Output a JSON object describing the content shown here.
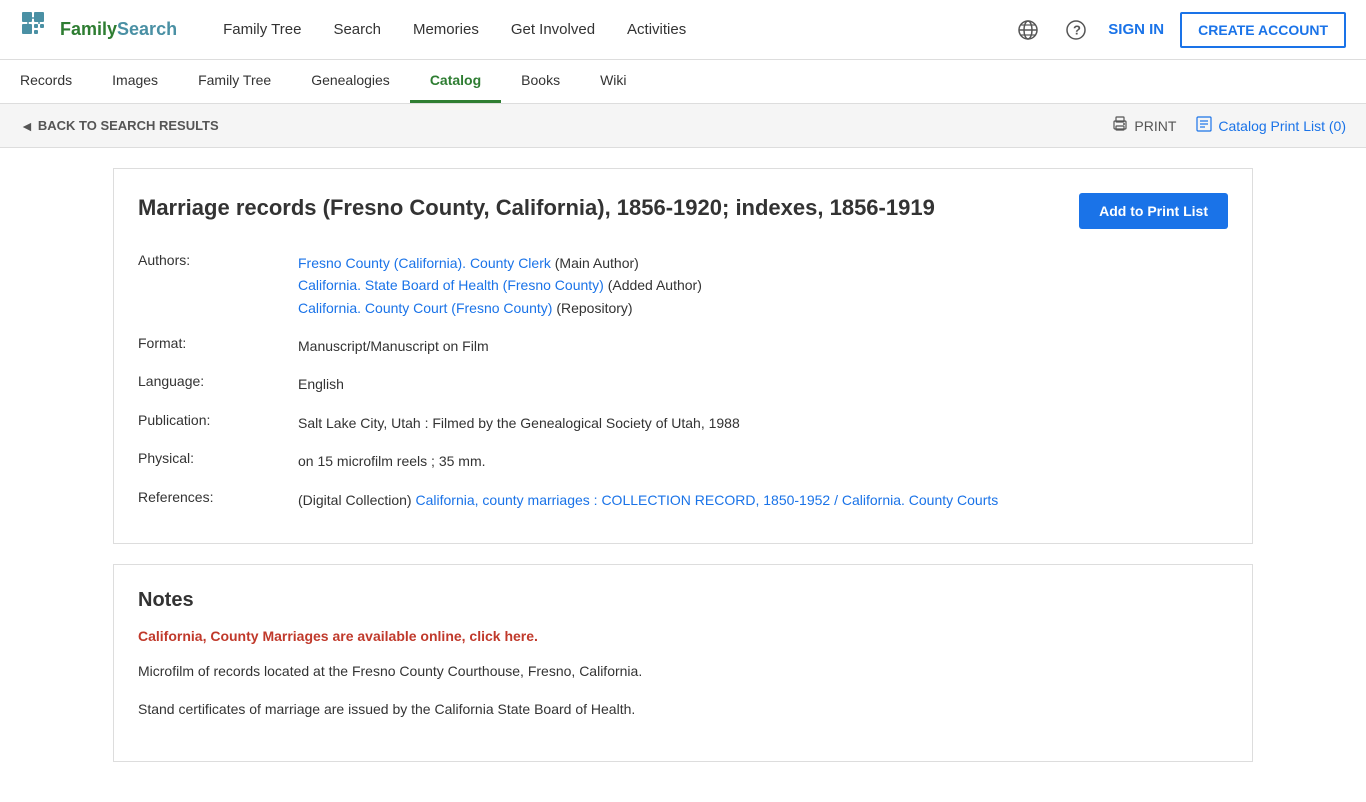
{
  "logo": {
    "brand_name": "FamilySearch",
    "brand_prefix": "Family",
    "brand_suffix": "Search"
  },
  "top_nav": {
    "items": [
      {
        "id": "family-tree",
        "label": "Family Tree"
      },
      {
        "id": "search",
        "label": "Search"
      },
      {
        "id": "memories",
        "label": "Memories"
      },
      {
        "id": "get-involved",
        "label": "Get Involved"
      },
      {
        "id": "activities",
        "label": "Activities"
      }
    ],
    "sign_in_label": "SIGN IN",
    "create_account_label": "CREATE ACCOUNT"
  },
  "sub_nav": {
    "items": [
      {
        "id": "records",
        "label": "Records",
        "active": false
      },
      {
        "id": "images",
        "label": "Images",
        "active": false
      },
      {
        "id": "family-tree",
        "label": "Family Tree",
        "active": false
      },
      {
        "id": "genealogies",
        "label": "Genealogies",
        "active": false
      },
      {
        "id": "catalog",
        "label": "Catalog",
        "active": true
      },
      {
        "id": "books",
        "label": "Books",
        "active": false
      },
      {
        "id": "wiki",
        "label": "Wiki",
        "active": false
      }
    ]
  },
  "breadcrumb": {
    "back_label": "BACK TO SEARCH RESULTS",
    "print_label": "PRINT",
    "catalog_print_label": "Catalog Print List (0)"
  },
  "record": {
    "title": "Marriage records (Fresno County, California), 1856-1920; indexes, 1856-1919",
    "add_to_print_label": "Add to Print List",
    "authors_label": "Authors:",
    "authors": [
      {
        "name": "Fresno County (California). County Clerk",
        "role": " (Main Author)"
      },
      {
        "name": "California. State Board of Health (Fresno County)",
        "role": " (Added Author)"
      },
      {
        "name": "California. County Court (Fresno County)",
        "role": " (Repository)"
      }
    ],
    "format_label": "Format:",
    "format_value": "Manuscript/Manuscript on Film",
    "language_label": "Language:",
    "language_value": "English",
    "publication_label": "Publication:",
    "publication_value": "Salt Lake City, Utah : Filmed by the Genealogical Society of Utah, 1988",
    "physical_label": "Physical:",
    "physical_value": "on 15 microfilm reels ; 35 mm.",
    "references_label": "References:",
    "references_prefix": "(Digital Collection) ",
    "references_link_text": "California, county marriages : COLLECTION RECORD, 1850-1952 / California. County Courts",
    "references_link_href": "#"
  },
  "notes": {
    "section_title": "Notes",
    "highlight_text": "California, County Marriages are available online, click here.",
    "paragraph1": "Microfilm of records located at the Fresno County Courthouse, Fresno, California.",
    "paragraph2": "Stand certificates of marriage are issued by the California State Board of Health."
  }
}
